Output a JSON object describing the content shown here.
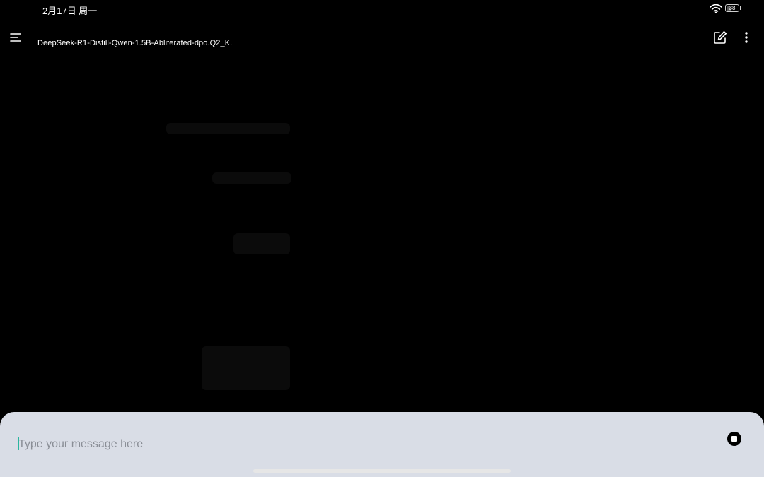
{
  "status_bar": {
    "time": "2月17日 周一",
    "battery_level": "38",
    "battery_fraction": 0.38,
    "wifi_icon": "wifi-icon",
    "battery_icon": "battery-icon"
  },
  "header": {
    "menu_icon": "menu-icon",
    "title": "DeepSeek-R1-Distill-Qwen-1.5B-Abliterated-dpo.Q2_K.",
    "new_chat_icon": "edit-icon",
    "more_icon": "more-vertical-icon"
  },
  "composer": {
    "placeholder": "Type your message here",
    "value": "",
    "stop_icon": "stop-icon"
  },
  "colors": {
    "background": "#000000",
    "composer_background": "#d9dde6",
    "caret": "#2bb5a0",
    "text": "#ffffff"
  }
}
